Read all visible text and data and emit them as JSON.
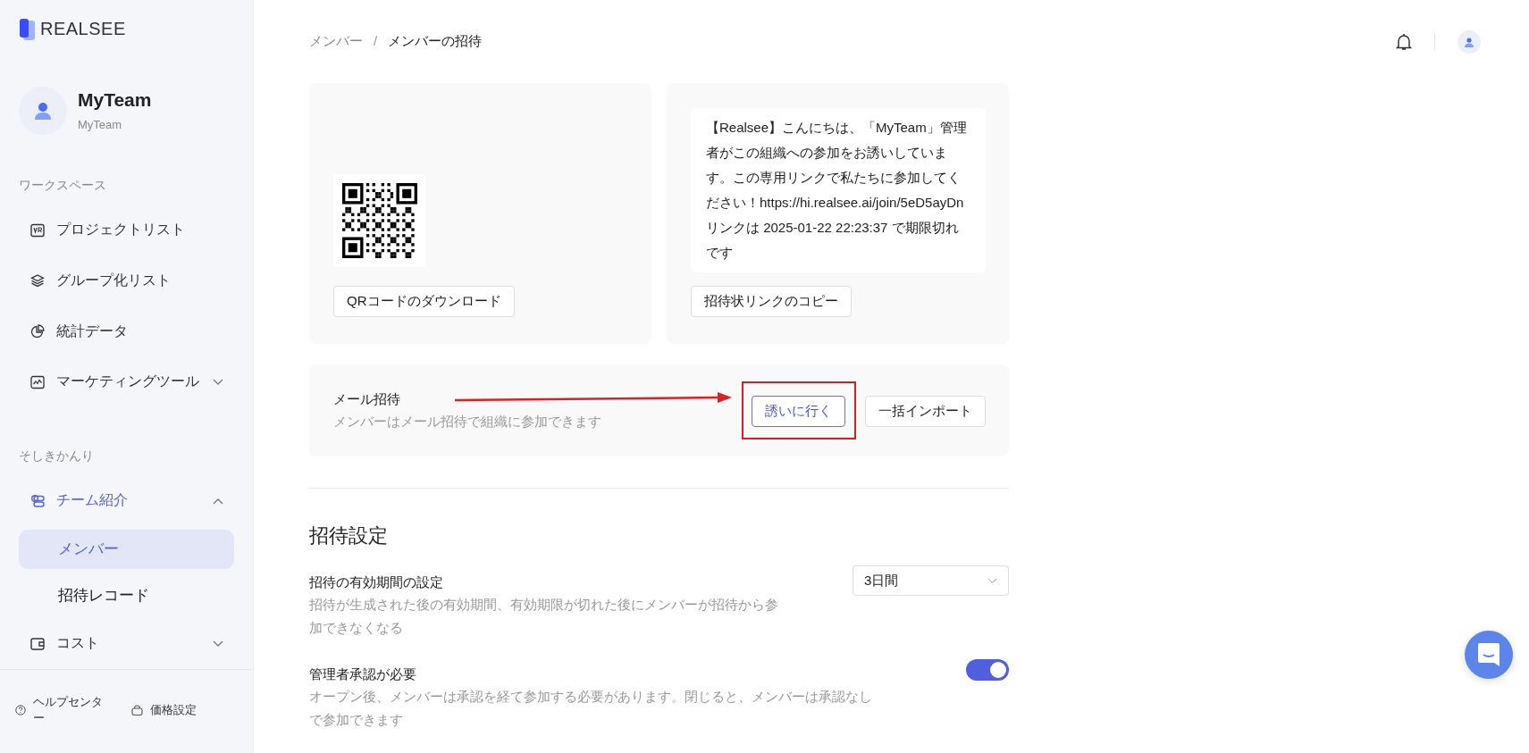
{
  "sidebar": {
    "logo": "REALSEE",
    "team": {
      "name": "MyTeam",
      "subtitle": "MyTeam"
    },
    "sections": [
      {
        "title": "ワークスペース",
        "items": [
          {
            "label": "プロジェクトリスト",
            "selected": false
          },
          {
            "label": "グループ化リスト",
            "selected": false
          },
          {
            "label": "統計データ",
            "selected": false
          },
          {
            "label": "マーケティングツール",
            "selected": false,
            "expanded": false
          }
        ]
      },
      {
        "title": "そしきかんり",
        "items": [
          {
            "label": "チーム紹介",
            "selected": true,
            "expanded": true,
            "children": [
              {
                "label": "メンバー",
                "selected": true
              },
              {
                "label": "招待レコード",
                "selected": false
              }
            ]
          },
          {
            "label": "コスト",
            "selected": false,
            "expanded": false
          }
        ]
      }
    ],
    "footer": [
      {
        "label": "ヘルプセンター"
      },
      {
        "label": "価格設定"
      }
    ]
  },
  "breadcrumb_separator": "/",
  "breadcrumb": [
    {
      "label": "メンバー",
      "current": false
    },
    {
      "label": "メンバーの招待",
      "current": true
    }
  ],
  "qr_card": {
    "button": "QRコードのダウンロード"
  },
  "link_card": {
    "message": "【Realsee】こんにちは、「MyTeam」管理者がこの組織への参加をお誘いしています。この専用リンクで私たちに参加してください！https://hi.realsee.ai/join/5eD5ayDnリンクは 2025-01-22 22:23:37 で期限切れです",
    "button": "招待状リンクのコピー"
  },
  "mail_invite": {
    "title": "メール招待",
    "description": "メンバーはメール招待で組織に参加できます",
    "buttons": [
      {
        "label": "誘いに行く",
        "primary": true,
        "highlighted": true
      },
      {
        "label": "一括インポート",
        "primary": false,
        "highlighted": false
      }
    ]
  },
  "settings": {
    "title": "招待設定",
    "items": [
      {
        "kind": "select",
        "label": "招待の有効期間の設定",
        "description": "招待が生成された後の有効期間、有効期限が切れた後にメンバーが招待から参加できなくなる",
        "value": "3日間"
      },
      {
        "kind": "toggle",
        "label": "管理者承認が必要",
        "description": "オープン後、メンバーは承認を経て参加する必要があります。閉じると、メンバーは承認なしで参加できます",
        "on": true
      }
    ]
  }
}
